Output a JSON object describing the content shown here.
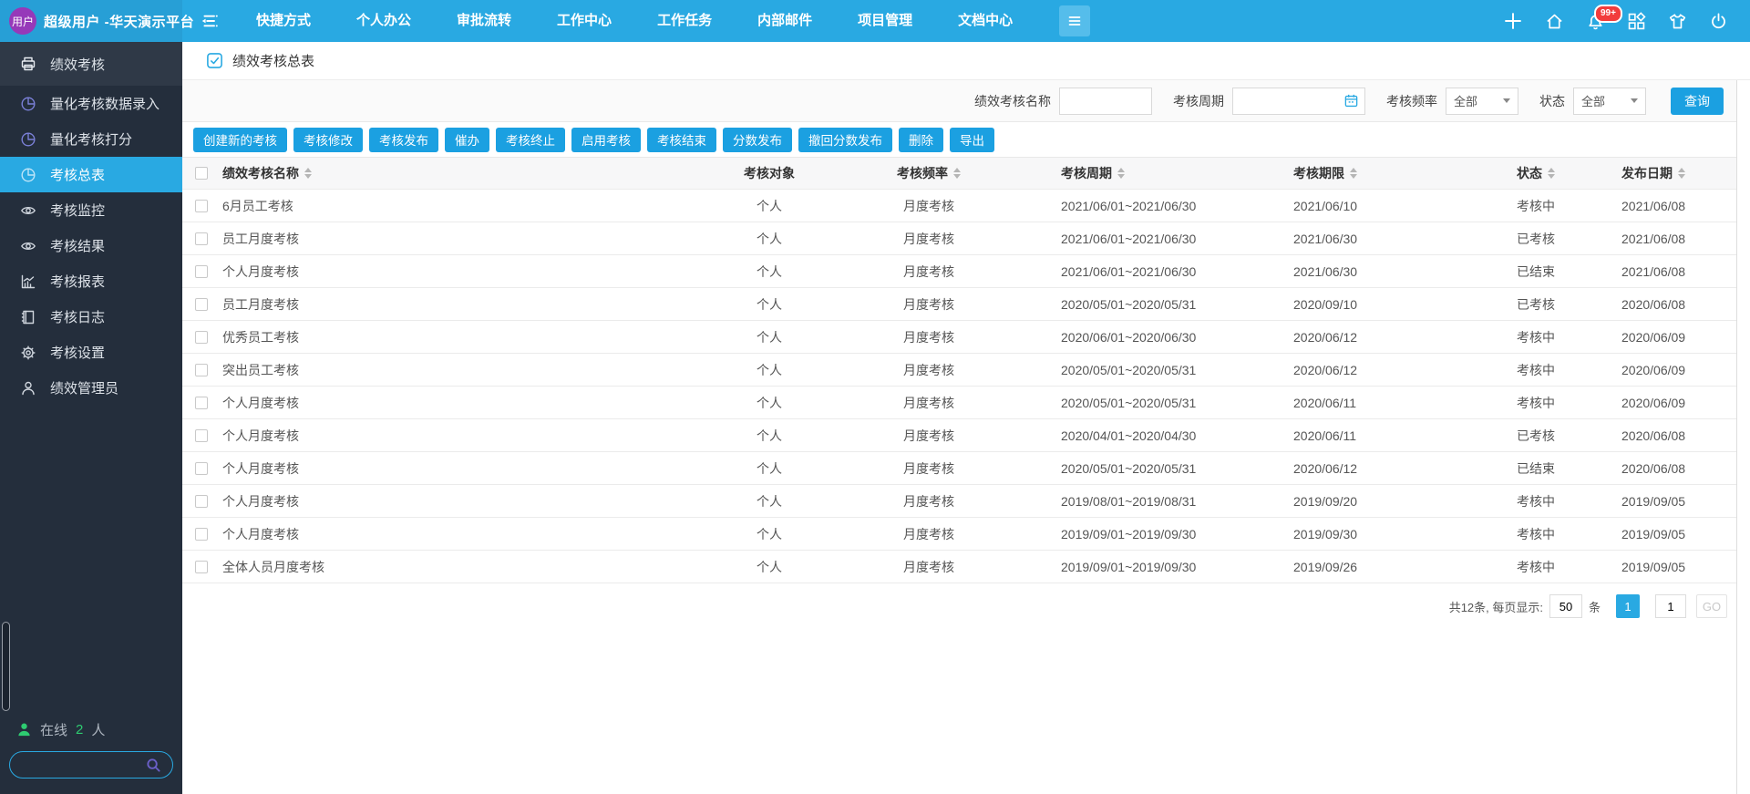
{
  "colors": {
    "topbar": "#29a9e2",
    "action_button": "#1ba0e1",
    "sidebar_bg": "#242e3c",
    "active_item": "#29a9e2",
    "badge_red": "#f23c3c",
    "online_green": "#2ecc71",
    "avatar_purple": "#9639b9"
  },
  "topbar": {
    "logo_badge": "用户",
    "title": "超级用户 -华天演示平台",
    "menu": [
      "快捷方式",
      "个人办公",
      "审批流转",
      "工作中心",
      "工作任务",
      "内部邮件",
      "项目管理",
      "文档中心"
    ],
    "notification_badge": "99+"
  },
  "sidebar": {
    "items": [
      {
        "label": "绩效考核",
        "icon": "printer-icon",
        "type": "group"
      },
      {
        "label": "量化考核数据录入",
        "icon": "pie-icon"
      },
      {
        "label": "量化考核打分",
        "icon": "pie-icon"
      },
      {
        "label": "考核总表",
        "icon": "pie-icon",
        "active": true
      },
      {
        "label": "考核监控",
        "icon": "eye-icon"
      },
      {
        "label": "考核结果",
        "icon": "eye-icon"
      },
      {
        "label": "考核报表",
        "icon": "chart-icon"
      },
      {
        "label": "考核日志",
        "icon": "journal-icon"
      },
      {
        "label": "考核设置",
        "icon": "gear-icon"
      },
      {
        "label": "绩效管理员",
        "icon": "user-icon"
      }
    ],
    "online_label": "在线",
    "online_count": "2",
    "online_unit": "人"
  },
  "breadcrumb": {
    "title": "绩效考核总表"
  },
  "filters": {
    "name_label": "绩效考核名称",
    "name_value": "",
    "period_label": "考核周期",
    "period_value": "",
    "freq_label": "考核频率",
    "freq_value": "全部",
    "status_label": "状态",
    "status_value": "全部",
    "search_button": "查询"
  },
  "toolbar": {
    "buttons": [
      "创建新的考核",
      "考核修改",
      "考核发布",
      "催办",
      "考核终止",
      "启用考核",
      "考核结束",
      "分数发布",
      "撤回分数发布",
      "删除",
      "导出"
    ]
  },
  "table": {
    "columns": [
      {
        "label": "绩效考核名称",
        "sortable": true
      },
      {
        "label": "考核对象",
        "sortable": false
      },
      {
        "label": "考核频率",
        "sortable": true
      },
      {
        "label": "考核周期",
        "sortable": true
      },
      {
        "label": "考核期限",
        "sortable": true
      },
      {
        "label": "状态",
        "sortable": true
      },
      {
        "label": "发布日期",
        "sortable": true
      }
    ],
    "rows": [
      {
        "name": "6月员工考核",
        "target": "个人",
        "freq": "月度考核",
        "period": "2021/06/01~2021/06/30",
        "deadline": "2021/06/10",
        "status": "考核中",
        "pub_date": "2021/06/08"
      },
      {
        "name": "员工月度考核",
        "target": "个人",
        "freq": "月度考核",
        "period": "2021/06/01~2021/06/30",
        "deadline": "2021/06/30",
        "status": "已考核",
        "pub_date": "2021/06/08"
      },
      {
        "name": "个人月度考核",
        "target": "个人",
        "freq": "月度考核",
        "period": "2021/06/01~2021/06/30",
        "deadline": "2021/06/30",
        "status": "已结束",
        "pub_date": "2021/06/08"
      },
      {
        "name": "员工月度考核",
        "target": "个人",
        "freq": "月度考核",
        "period": "2020/05/01~2020/05/31",
        "deadline": "2020/09/10",
        "status": "已考核",
        "pub_date": "2020/06/08"
      },
      {
        "name": "优秀员工考核",
        "target": "个人",
        "freq": "月度考核",
        "period": "2020/06/01~2020/06/30",
        "deadline": "2020/06/12",
        "status": "考核中",
        "pub_date": "2020/06/09"
      },
      {
        "name": "突出员工考核",
        "target": "个人",
        "freq": "月度考核",
        "period": "2020/05/01~2020/05/31",
        "deadline": "2020/06/12",
        "status": "考核中",
        "pub_date": "2020/06/09"
      },
      {
        "name": "个人月度考核",
        "target": "个人",
        "freq": "月度考核",
        "period": "2020/05/01~2020/05/31",
        "deadline": "2020/06/11",
        "status": "考核中",
        "pub_date": "2020/06/09"
      },
      {
        "name": "个人月度考核",
        "target": "个人",
        "freq": "月度考核",
        "period": "2020/04/01~2020/04/30",
        "deadline": "2020/06/11",
        "status": "已考核",
        "pub_date": "2020/06/08"
      },
      {
        "name": "个人月度考核",
        "target": "个人",
        "freq": "月度考核",
        "period": "2020/05/01~2020/05/31",
        "deadline": "2020/06/12",
        "status": "已结束",
        "pub_date": "2020/06/08"
      },
      {
        "name": "个人月度考核",
        "target": "个人",
        "freq": "月度考核",
        "period": "2019/08/01~2019/08/31",
        "deadline": "2019/09/20",
        "status": "考核中",
        "pub_date": "2019/09/05"
      },
      {
        "name": "个人月度考核",
        "target": "个人",
        "freq": "月度考核",
        "period": "2019/09/01~2019/09/30",
        "deadline": "2019/09/30",
        "status": "考核中",
        "pub_date": "2019/09/05"
      },
      {
        "name": "全体人员月度考核",
        "target": "个人",
        "freq": "月度考核",
        "period": "2019/09/01~2019/09/30",
        "deadline": "2019/09/26",
        "status": "考核中",
        "pub_date": "2019/09/05"
      }
    ]
  },
  "pagination": {
    "total_text": "共12条, 每页显示:",
    "page_size": "50",
    "unit": "条",
    "current_page": "1",
    "goto_value": "1",
    "go_label": "GO"
  }
}
